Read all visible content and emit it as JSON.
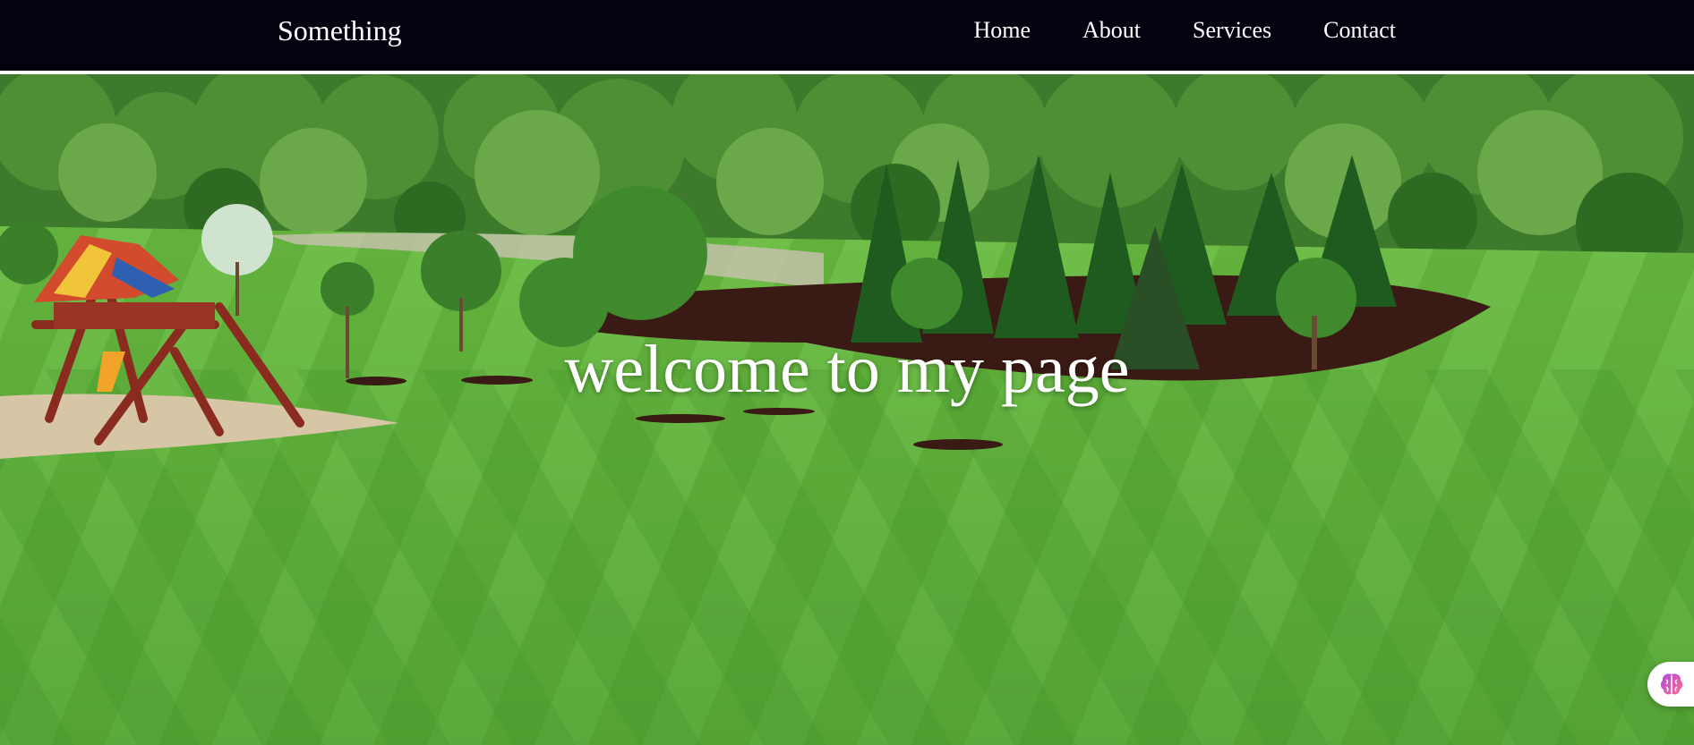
{
  "header": {
    "brand": "Something",
    "nav": [
      {
        "label": "Home"
      },
      {
        "label": "About"
      },
      {
        "label": "Services"
      },
      {
        "label": "Contact"
      }
    ]
  },
  "hero": {
    "title": "welcome to my page"
  },
  "widgets": {
    "assistant_icon": "brain-icon"
  },
  "colors": {
    "navbar_bg": "#03020f",
    "nav_text": "#ffffff",
    "lawn_light": "#5fb33c",
    "lawn_dark": "#3e8f2a",
    "mulch": "#3a1a14"
  }
}
